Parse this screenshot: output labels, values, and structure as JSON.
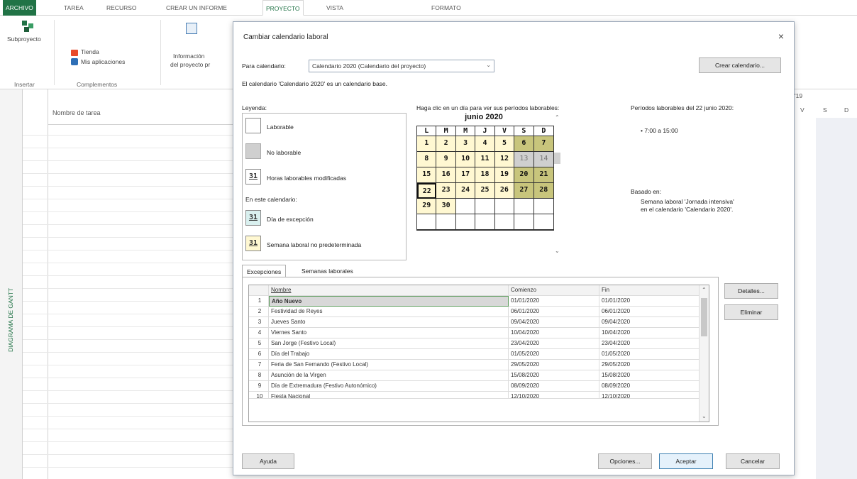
{
  "ribbon_tabs": [
    "ARCHIVO",
    "TAREA",
    "RECURSO",
    "CREAR UN INFORME",
    "PROYECTO",
    "VISTA",
    "FORMATO"
  ],
  "ribbon": {
    "subproyecto": "Subproyecto",
    "insertar": "Insertar",
    "tienda": "Tienda",
    "mis_aplicaciones": "Mis aplicaciones",
    "complementos": "Complementos",
    "informacion_1": "Información",
    "informacion_2": "del proyecto pr"
  },
  "gantt": {
    "view_label": "DIAGRAMA DE GANTT",
    "task_col": "Nombre de tarea",
    "right_days": [
      "V",
      "S",
      "D"
    ],
    "right_year": "'19"
  },
  "dialog": {
    "title": "Cambiar calendario laboral",
    "close": "×",
    "para_calendario": "Para calendario:",
    "calendar_value": "Calendario 2020 (Calendario del proyecto)",
    "crear_calendario": "Crear calendario...",
    "base_note": "El calendario 'Calendario 2020' es un calendario base.",
    "leyenda": "Leyenda:",
    "legend": {
      "laborable": "Laborable",
      "no_laborable": "No laborable",
      "horas_modificadas": "Horas laborables modificadas",
      "en_este_calendario": "En este calendario:",
      "dia_excepcion": "Día de excepción",
      "semana_no_pred": "Semana laboral no predeterminada",
      "num": "31"
    },
    "haga_clic": "Haga clic en un día para ver sus períodos laborables:",
    "periodos_title": "Períodos laborables del 22 junio 2020:",
    "periodos_value": "• 7:00 a 15:00",
    "basado_en": "Basado en:",
    "basado_text_1": "Semana laboral 'Jornada intensiva'",
    "basado_text_2": "en el calendario 'Calendario 2020'.",
    "calendar": {
      "month": "junio 2020",
      "dow": [
        "L",
        "M",
        "M",
        "J",
        "V",
        "S",
        "D"
      ],
      "weeks": [
        [
          "1",
          "2",
          "3",
          "4",
          "5",
          "6",
          "7"
        ],
        [
          "8",
          "9",
          "10",
          "11",
          "12",
          "13",
          "14"
        ],
        [
          "15",
          "16",
          "17",
          "18",
          "19",
          "20",
          "21"
        ],
        [
          "22",
          "23",
          "24",
          "25",
          "26",
          "27",
          "28"
        ],
        [
          "29",
          "30",
          "",
          "",
          "",
          "",
          ""
        ],
        [
          "",
          "",
          "",
          "",
          "",
          "",
          ""
        ]
      ]
    },
    "tabs": [
      "Excepciones",
      "Semanas laborales"
    ],
    "exceptions": {
      "headers": [
        "Nombre",
        "Comienzo",
        "Fin"
      ],
      "rows": [
        [
          "1",
          "Año Nuevo",
          "01/01/2020",
          "01/01/2020"
        ],
        [
          "2",
          "Festividad de Reyes",
          "06/01/2020",
          "06/01/2020"
        ],
        [
          "3",
          "Jueves Santo",
          "09/04/2020",
          "09/04/2020"
        ],
        [
          "4",
          "Viernes Santo",
          "10/04/2020",
          "10/04/2020"
        ],
        [
          "5",
          "San Jorge (Festivo Local)",
          "23/04/2020",
          "23/04/2020"
        ],
        [
          "6",
          "Día del Trabajo",
          "01/05/2020",
          "01/05/2020"
        ],
        [
          "7",
          "Feria de San Fernando (Festivo Local)",
          "29/05/2020",
          "29/05/2020"
        ],
        [
          "8",
          "Asunción de la Virgen",
          "15/08/2020",
          "15/08/2020"
        ],
        [
          "9",
          "Día de Extremadura (Festivo Autonómico)",
          "08/09/2020",
          "08/09/2020"
        ],
        [
          "10",
          "Fiesta Nacional",
          "12/10/2020",
          "12/10/2020"
        ]
      ]
    },
    "detalles": "Detalles...",
    "eliminar": "Eliminar",
    "ayuda": "Ayuda",
    "opciones": "Opciones...",
    "aceptar": "Aceptar",
    "cancelar": "Cancelar"
  }
}
